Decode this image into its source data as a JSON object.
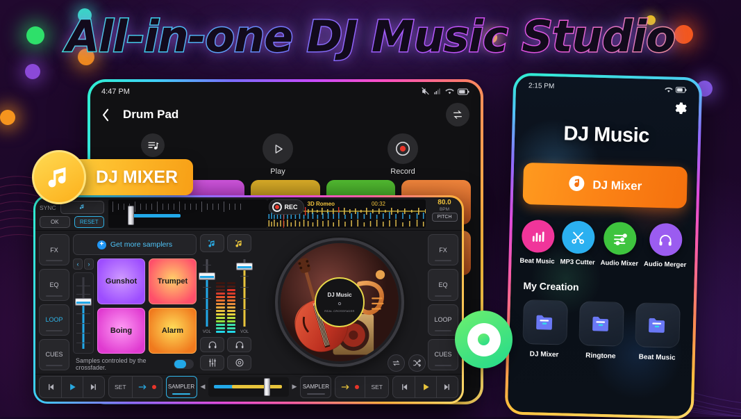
{
  "hero": {
    "title": "All-in-one DJ Music Studio"
  },
  "badges": {
    "dj_mixer": {
      "label": "DJ MIXER",
      "icon": "music-note-icon"
    },
    "disc": {
      "icon": "vinyl-record-icon"
    }
  },
  "left_phone": {
    "statusbar": {
      "time": "4:47 PM",
      "icons": [
        "mute-icon",
        "signal-icon",
        "wifi-icon",
        "battery-icon"
      ]
    },
    "appbar": {
      "back": "chevron-left-icon",
      "title": "Drum Pad",
      "action": "swap-icon"
    },
    "transport": [
      {
        "name": "playlist",
        "icon": "playlist-icon",
        "label": ""
      },
      {
        "name": "play",
        "icon": "play-icon",
        "label": "Play"
      },
      {
        "name": "record",
        "icon": "record-icon",
        "label": "Record"
      }
    ],
    "pads": [
      {
        "color": "#2f7fc4"
      },
      {
        "color": "#b83bc4"
      },
      {
        "color": "#c49a1e"
      },
      {
        "color": "#46a82a"
      },
      {
        "color": "#e0712f"
      }
    ]
  },
  "mixer": {
    "sync": {
      "label": "SYNC",
      "note_icon": "music-note-icon",
      "ok": "OK",
      "reset": "RESET"
    },
    "track": {
      "title": "3D Romeo",
      "time": "00:32",
      "bpm_value": "80.0",
      "bpm_label": "BPM",
      "pitch": "PITCH"
    },
    "rec": {
      "label": "REC",
      "icon": "record-icon"
    },
    "left_side": [
      "FX",
      "EQ",
      "LOOP",
      "CUES"
    ],
    "right_side": [
      "FX",
      "EQ",
      "LOOP",
      "CUES"
    ],
    "sampler": {
      "get_more": "Get more samplers",
      "prev": "‹",
      "next": "›",
      "pads": [
        {
          "label": "Gunshot",
          "c1": "#c48bff",
          "c2": "#9d4dff"
        },
        {
          "label": "Trumpet",
          "c1": "#ffd06a",
          "c2": "#ff4f6a"
        },
        {
          "label": "Boing",
          "c1": "#ff8bf0",
          "c2": "#e03ad0"
        },
        {
          "label": "Alarm",
          "c1": "#ffd24a",
          "c2": "#f07a1e"
        }
      ],
      "crossfade_note": "Samples controled by the crossfader."
    },
    "mid": {
      "btn_left_icon": "add-music-blue-icon",
      "btn_right_icon": "add-music-yellow-icon",
      "vol_left_label": "VOL",
      "vol_right_label": "VOL",
      "headphone_icon": "headphones-icon",
      "eq_icon": "equalizer-icon",
      "target_icon": "target-icon"
    },
    "deck": {
      "center_title": "DJ Music",
      "center_sub": "REAL CROSSFADER",
      "shuffle_icon": "shuffle-icon",
      "repeat_icon": "repeat-icon"
    },
    "footer": {
      "left_transport": [
        "skip-previous-icon",
        "play-icon",
        "skip-next-icon"
      ],
      "left_set": {
        "label": "SET",
        "arrow_icon": "arrow-right-icon",
        "dot": "record-dot"
      },
      "sampler_tab": "SAMPLER",
      "right_sampler_tab": "SAMPLER",
      "right_set": {
        "label": "SET",
        "arrow_icon": "arrow-right-icon",
        "dot": "record-dot"
      },
      "right_transport": [
        "skip-previous-icon",
        "play-icon",
        "skip-next-icon"
      ]
    }
  },
  "right_phone": {
    "statusbar": {
      "time": "2:15 PM",
      "icons": [
        "wifi-icon",
        "battery-icon"
      ]
    },
    "settings_icon": "gear-icon",
    "title": "DJ Music",
    "primary_button": {
      "label": "DJ Mixer",
      "icon": "dj-disc-icon",
      "color": "#fb8115"
    },
    "features": [
      {
        "label": "Beat Music",
        "icon": "bar-chart-icon",
        "color": "#f0359a"
      },
      {
        "label": "MP3 Cutter",
        "icon": "scissors-icon",
        "color": "#2bb0f0"
      },
      {
        "label": "Audio Mixer",
        "icon": "sliders-icon",
        "color": "#3ec43e"
      },
      {
        "label": "Audio Merger",
        "icon": "headphones-icon",
        "color": "#9b5cf0"
      }
    ],
    "my_creation": {
      "heading": "My Creation",
      "items": [
        {
          "label": "DJ Mixer",
          "icon": "folder-icon"
        },
        {
          "label": "Ringtone",
          "icon": "folder-icon"
        },
        {
          "label": "Beat Music",
          "icon": "folder-icon"
        }
      ]
    }
  }
}
